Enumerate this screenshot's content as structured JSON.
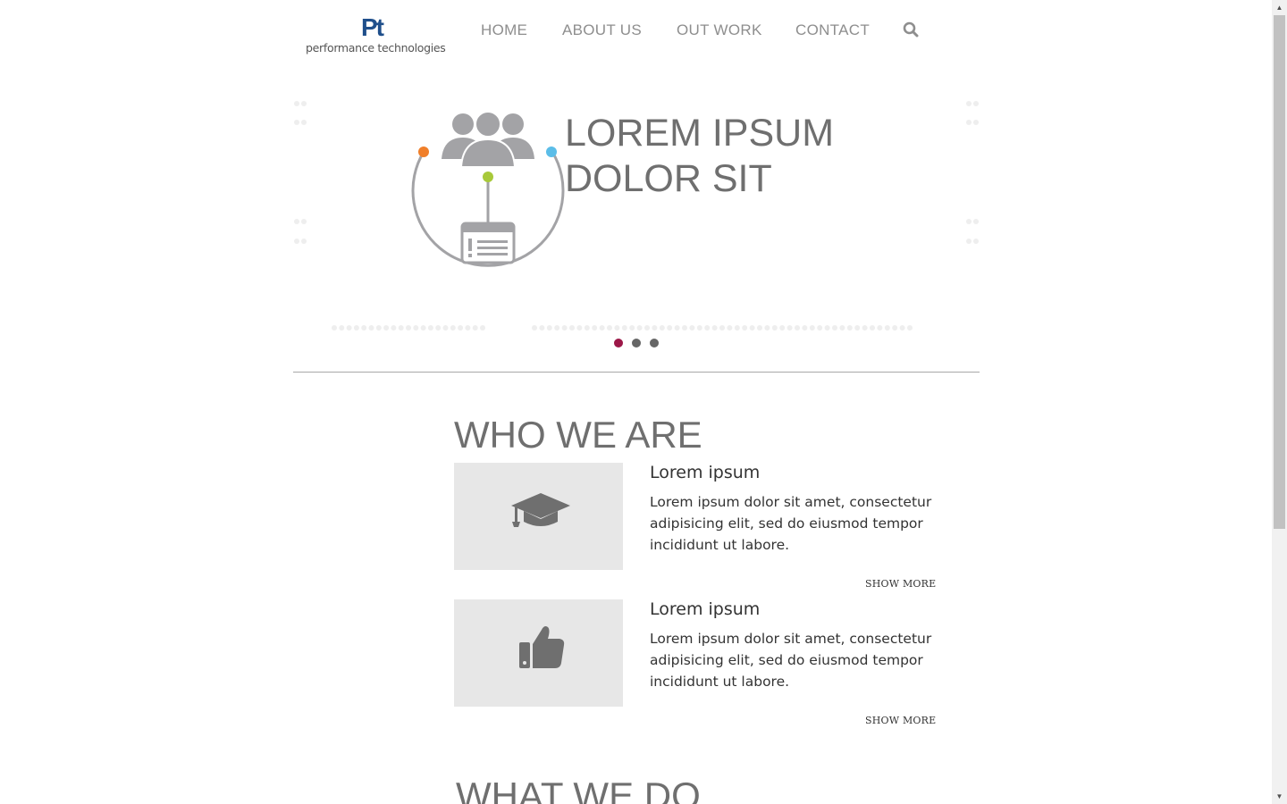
{
  "header": {
    "logo_mark": "Pt",
    "logo_text": "performance technologies",
    "nav": [
      {
        "label": "HOME"
      },
      {
        "label": "ABOUT US"
      },
      {
        "label": "OUT WORK"
      },
      {
        "label": "CONTACT"
      }
    ],
    "search_icon": "search-icon"
  },
  "hero": {
    "title_line1": "LOREM IPSUM",
    "title_line2": "DOLOR SIT",
    "illustration": "people-network-icon",
    "slides": {
      "count": 3,
      "active": 1
    },
    "colors": {
      "active_dot": "#9c1848",
      "inactive_dot": "#666666",
      "node_orange": "#f07f2a",
      "node_blue": "#5bbde8",
      "node_green": "#a8c93a"
    }
  },
  "who_we_are": {
    "title": "WHO WE ARE",
    "cards": [
      {
        "icon": "graduation-cap-icon",
        "title": "Lorem ipsum",
        "text": "Lorem ipsum dolor sit amet, consectetur adipisicing elit, sed do eiusmod tempor incididunt ut labore.",
        "more": "SHOW MORE"
      },
      {
        "icon": "thumbs-up-icon",
        "title": "Lorem ipsum",
        "text": "Lorem ipsum dolor sit amet, consectetur adipisicing elit, sed do eiusmod tempor incididunt ut labore.",
        "more": "SHOW MORE"
      }
    ]
  },
  "what_we_do": {
    "title": "WHAT WE DO"
  }
}
